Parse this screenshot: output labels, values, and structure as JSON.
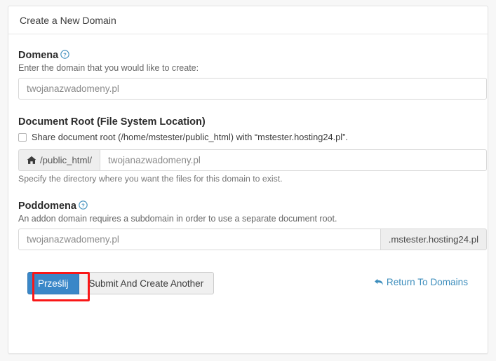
{
  "panel": {
    "title": "Create a New Domain"
  },
  "domain_section": {
    "label": "Domena",
    "help_icon": "question-circle-icon",
    "description": "Enter the domain that you would like to create:",
    "input_placeholder": "twojanazwadomeny.pl",
    "input_value": ""
  },
  "docroot_section": {
    "label": "Document Root (File System Location)",
    "checkbox_label": "Share document root (/home/mstester/public_html) with “mstester.hosting24.pl”.",
    "checkbox_checked": false,
    "addon_icon": "home-icon",
    "addon_text": "/public_html/",
    "input_placeholder": "twojanazwadomeny.pl",
    "input_value": "",
    "hint": "Specify the directory where you want the files for this domain to exist."
  },
  "subdomain_section": {
    "label": "Poddomena",
    "help_icon": "question-circle-icon",
    "description": "An addon domain requires a subdomain in order to use a separate document root.",
    "input_placeholder": "twojanazwadomeny.pl",
    "input_value": "",
    "addon_text": ".mstester.hosting24.pl"
  },
  "footer": {
    "submit_label": "Prześlij",
    "submit_and_create_label": "Submit And Create Another",
    "return_link_label": "Return To Domains",
    "return_icon": "undo-arrow-icon"
  },
  "colors": {
    "primary": "#3a87c8",
    "link": "#3c8dbc",
    "highlight": "#f91717",
    "page_background": "#f7f7f7",
    "panel_background": "#ffffff"
  }
}
